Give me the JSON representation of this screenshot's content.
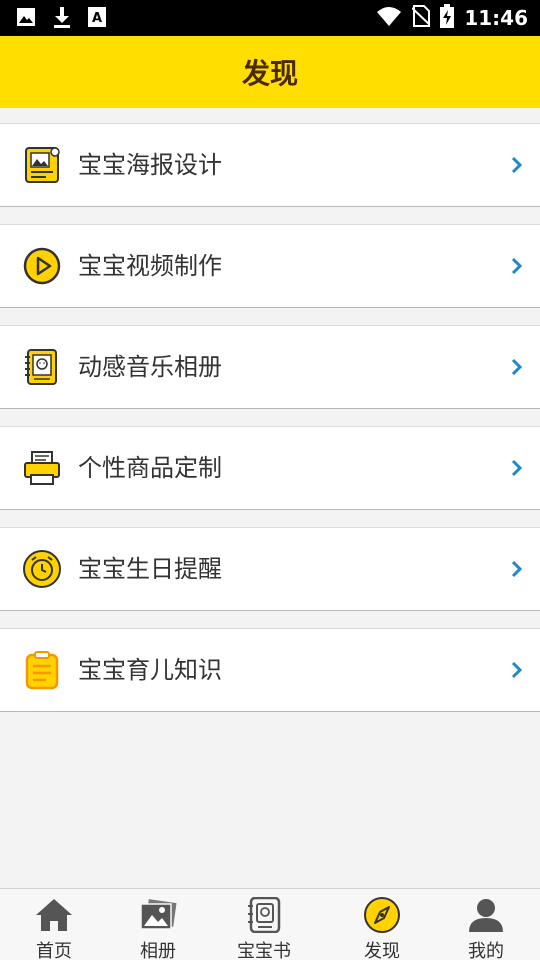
{
  "status_bar": {
    "time": "11:46",
    "icons": [
      "image-icon",
      "download-icon",
      "text-a-icon",
      "wifi-icon",
      "no-sim-icon",
      "battery-charging-icon"
    ]
  },
  "header": {
    "title": "发现"
  },
  "menu": {
    "items": [
      {
        "label": "宝宝海报设计",
        "icon": "poster-icon"
      },
      {
        "label": "宝宝视频制作",
        "icon": "play-icon"
      },
      {
        "label": "动感音乐相册",
        "icon": "music-album-icon"
      },
      {
        "label": "个性商品定制",
        "icon": "printer-icon"
      },
      {
        "label": "宝宝生日提醒",
        "icon": "alarm-clock-icon"
      },
      {
        "label": "宝宝育儿知识",
        "icon": "clipboard-icon"
      }
    ]
  },
  "tabbar": {
    "tabs": [
      {
        "label": "首页",
        "icon": "home-icon"
      },
      {
        "label": "相册",
        "icon": "photos-icon"
      },
      {
        "label": "宝宝书",
        "icon": "baby-book-icon"
      },
      {
        "label": "发现",
        "icon": "compass-icon",
        "active": true
      },
      {
        "label": "我的",
        "icon": "user-icon"
      }
    ]
  },
  "colors": {
    "accent": "#ffde00",
    "title_text": "#4a2a00",
    "arrow": "#1e88c8"
  }
}
